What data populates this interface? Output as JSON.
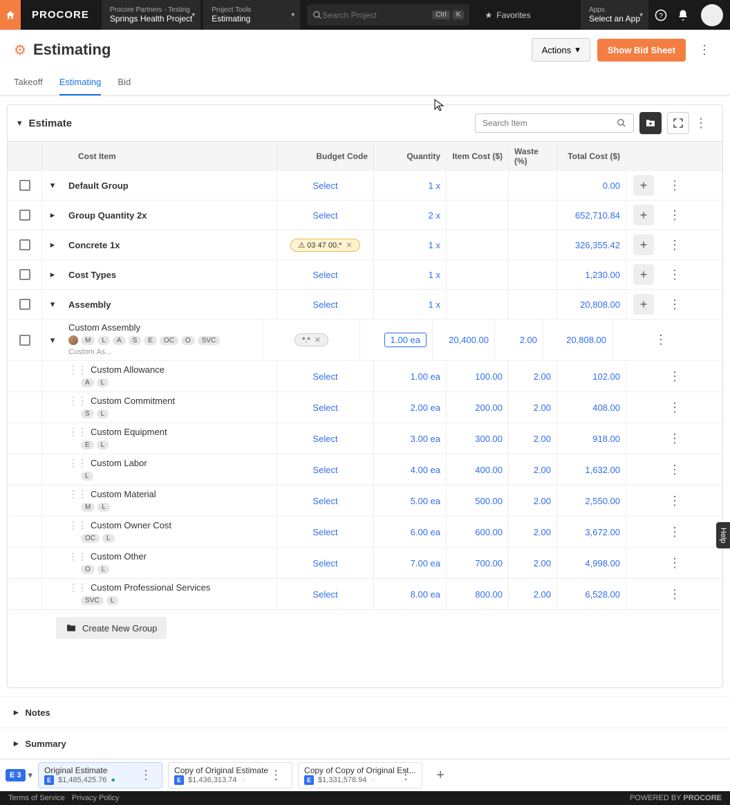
{
  "topbar": {
    "company_label": "Procore Partners - Testing",
    "project_name": "Springs Health Project",
    "tools_label": "Project Tools",
    "tool_name": "Estimating",
    "search_placeholder": "Search Project",
    "kbd1": "Ctrl",
    "kbd2": "K",
    "favorites": "Favorites",
    "apps_label": "Apps",
    "apps_select": "Select an App",
    "logo": "PROCORE"
  },
  "page": {
    "title": "Estimating",
    "actions_btn": "Actions",
    "show_bid": "Show Bid Sheet"
  },
  "tabs": [
    "Takeoff",
    "Estimating",
    "Bid"
  ],
  "panel": {
    "title": "Estimate",
    "search_placeholder": "Search Item",
    "create_group": "Create New Group"
  },
  "columns": {
    "cost_item": "Cost Item",
    "budget_code": "Budget Code",
    "quantity": "Quantity",
    "item_cost": "Item Cost ($)",
    "waste": "Waste (%)",
    "total_cost": "Total Cost ($)"
  },
  "groups": [
    {
      "name": "Default Group",
      "exp": "down",
      "budget": "Select",
      "qty": "1 x",
      "total": "0.00",
      "add": true
    },
    {
      "name": "Group Quantity 2x",
      "exp": "right",
      "budget": "Select",
      "qty": "2 x",
      "total": "652,710.84",
      "add": true
    },
    {
      "name": "Concrete 1x",
      "exp": "right",
      "budget_chip": "03 47 00.*",
      "qty": "1 x",
      "total": "326,355.42",
      "add": true
    },
    {
      "name": "Cost Types",
      "exp": "right",
      "budget": "Select",
      "qty": "1 x",
      "total": "1,230.00",
      "add": true
    },
    {
      "name": "Assembly",
      "exp": "down",
      "budget": "Select",
      "qty": "1 x",
      "total": "20,808.00",
      "add": true
    }
  ],
  "assembly": {
    "name": "Custom Assembly",
    "subtext": "Custom As...",
    "chips": [
      "M",
      "L",
      "A",
      "S",
      "E",
      "OC",
      "O",
      "SVC"
    ],
    "budget_chip": "*.*",
    "qty": "1.00 ea",
    "item_cost": "20,400.00",
    "waste": "2.00",
    "total": "20,808.00"
  },
  "lines": [
    {
      "name": "Custom Allowance",
      "chips": [
        "A",
        "L"
      ],
      "budget": "Select",
      "qty": "1.00 ea",
      "item": "100.00",
      "waste": "2.00",
      "total": "102.00"
    },
    {
      "name": "Custom Commitment",
      "chips": [
        "S",
        "L"
      ],
      "budget": "Select",
      "qty": "2.00 ea",
      "item": "200.00",
      "waste": "2.00",
      "total": "408.00"
    },
    {
      "name": "Custom Equipment",
      "chips": [
        "E",
        "L"
      ],
      "budget": "Select",
      "qty": "3.00 ea",
      "item": "300.00",
      "waste": "2.00",
      "total": "918.00"
    },
    {
      "name": "Custom Labor",
      "chips": [
        "L"
      ],
      "budget": "Select",
      "qty": "4.00 ea",
      "item": "400.00",
      "waste": "2.00",
      "total": "1,632.00"
    },
    {
      "name": "Custom Material",
      "chips": [
        "M",
        "L"
      ],
      "budget": "Select",
      "qty": "5.00 ea",
      "item": "500.00",
      "waste": "2.00",
      "total": "2,550.00"
    },
    {
      "name": "Custom Owner Cost",
      "chips": [
        "OC",
        "L"
      ],
      "budget": "Select",
      "qty": "6.00 ea",
      "item": "600.00",
      "waste": "2.00",
      "total": "3,672.00"
    },
    {
      "name": "Custom Other",
      "chips": [
        "O",
        "L"
      ],
      "budget": "Select",
      "qty": "7.00 ea",
      "item": "700.00",
      "waste": "2.00",
      "total": "4,998.00"
    },
    {
      "name": "Custom Professional Services",
      "chips": [
        "SVC",
        "L"
      ],
      "budget": "Select",
      "qty": "8.00 ea",
      "item": "800.00",
      "waste": "2.00",
      "total": "6,528.00"
    }
  ],
  "sections": {
    "notes": "Notes",
    "summary": "Summary"
  },
  "est_tabs": {
    "badge": "E 3",
    "items": [
      {
        "name": "Original Estimate",
        "amount": "$1,485,425.76",
        "check": true
      },
      {
        "name": "Copy of Original Estimate",
        "amount": "$1,436,313.74"
      },
      {
        "name": "Copy of Copy of Original Est...",
        "amount": "$1,331,578.94"
      }
    ]
  },
  "footer": {
    "terms": "Terms of Service",
    "privacy": "Privacy Policy",
    "powered": "POWERED BY",
    "brand": "PROCORE"
  },
  "help": "Help"
}
